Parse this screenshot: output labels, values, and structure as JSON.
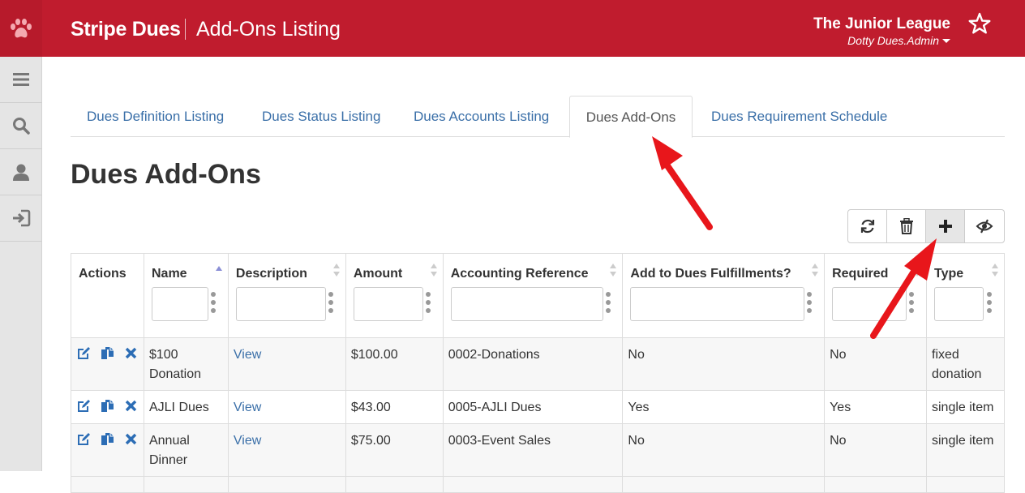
{
  "header": {
    "app_title": "Stripe Dues",
    "page_heading": "Add-Ons Listing",
    "org_name": "The Junior League",
    "user_name": "Dotty Dues.Admin"
  },
  "icons": {
    "logo": "paw-icon",
    "favorite": "star-icon",
    "sidebar": [
      "menu-icon",
      "search-icon",
      "user-icon",
      "sign-out-icon"
    ],
    "toolbar": [
      "refresh-icon",
      "trash-icon",
      "plus-icon",
      "eye-slash-icon"
    ],
    "row_actions": [
      "edit-icon",
      "copy-icon",
      "delete-icon"
    ]
  },
  "colors": {
    "brand": "#c01c2e",
    "link": "#3a6fa8",
    "annotation_arrow": "#e8161b"
  },
  "tabs": [
    {
      "label": "Dues Definition Listing"
    },
    {
      "label": "Dues Status Listing"
    },
    {
      "label": "Dues Accounts Listing"
    },
    {
      "label": "Dues Add-Ons",
      "active": true
    },
    {
      "label": "Dues Requirement Schedule"
    }
  ],
  "main": {
    "title": "Dues Add-Ons"
  },
  "table": {
    "columns": [
      {
        "label": "Actions"
      },
      {
        "label": "Name",
        "sort": "asc"
      },
      {
        "label": "Description"
      },
      {
        "label": "Amount"
      },
      {
        "label": "Accounting Reference"
      },
      {
        "label": "Add to Dues Fulfillments?"
      },
      {
        "label": "Required"
      },
      {
        "label": "Type"
      }
    ],
    "rows": [
      {
        "name": "$100 Donation",
        "description": "View",
        "amount": "$100.00",
        "accounting_reference": "0002-Donations",
        "fulfillments": "No",
        "required": "No",
        "type": "fixed donation"
      },
      {
        "name": "AJLI Dues",
        "description": "View",
        "amount": "$43.00",
        "accounting_reference": "0005-AJLI Dues",
        "fulfillments": "Yes",
        "required": "Yes",
        "type": "single item"
      },
      {
        "name": "Annual Dinner",
        "description": "View",
        "amount": "$75.00",
        "accounting_reference": "0003-Event Sales",
        "fulfillments": "No",
        "required": "No",
        "type": "single item"
      }
    ]
  }
}
